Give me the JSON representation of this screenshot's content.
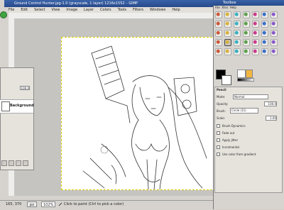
{
  "image_window": {
    "title": "Ground Control Hunter.jpg-1.0 (grayscale, 1 layer) 1216x1552 – GIMP",
    "menus": [
      "File",
      "Edit",
      "Select",
      "View",
      "Image",
      "Layer",
      "Colors",
      "Tools",
      "Filters",
      "Windows",
      "Help"
    ],
    "status": {
      "coords": "165, 370",
      "units": "px",
      "zoom": "102%",
      "hint": "Click to paint (Ctrl to pick a color)"
    }
  },
  "layers_dock": {
    "opacity_value": "100.0",
    "layer_name": "Background"
  },
  "toolbox": {
    "title": "Toolbox",
    "menus": [
      "File",
      "Xtns",
      "Help"
    ],
    "colors": {
      "foreground": "#000000",
      "background": "#ffffff"
    },
    "options": {
      "tool_name": "Pencil",
      "mode_label": "Mode:",
      "mode_value": "Normal",
      "opacity_label": "Opacity:",
      "opacity_value": "100.0",
      "brush_label": "Brush:",
      "brush_value": "Circle (11)",
      "scale_label": "Scale:",
      "scale_value": "1.00",
      "dynamics_label": "Brush Dynamics",
      "checkboxes": [
        "Fade out",
        "Apply Jitter",
        "Incremental",
        "Use color from gradient"
      ]
    }
  }
}
